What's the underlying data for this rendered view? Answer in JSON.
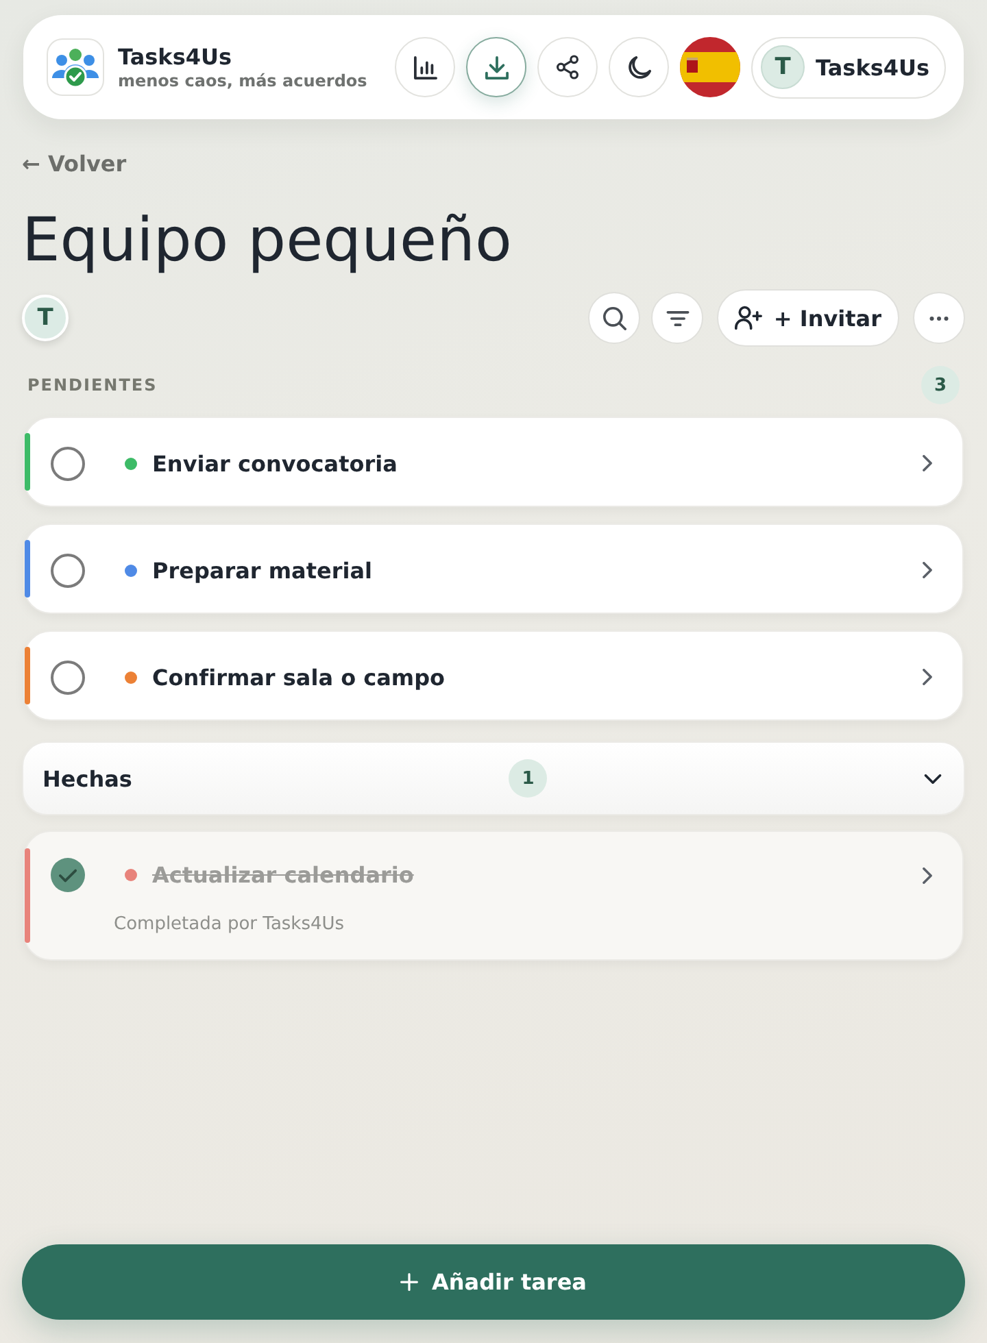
{
  "header": {
    "app_name": "Tasks4Us",
    "tagline": "menos caos, más acuerdos",
    "actions": [
      {
        "kind": "stats",
        "highlighted": false
      },
      {
        "kind": "download",
        "highlighted": true
      },
      {
        "kind": "share",
        "highlighted": false
      },
      {
        "kind": "theme",
        "highlighted": false
      },
      {
        "kind": "language",
        "highlighted": false
      }
    ],
    "user": {
      "initial": "T",
      "name": "Tasks4Us"
    }
  },
  "back_link": "← Volver",
  "title": "Equipo pequeño",
  "members": [
    {
      "initial": "T"
    }
  ],
  "toolbar": {
    "tools": [
      {
        "kind": "search"
      },
      {
        "kind": "filter"
      },
      {
        "kind": "invite",
        "label": "+ Invitar"
      },
      {
        "kind": "more"
      }
    ]
  },
  "pending": {
    "heading": "PENDIENTES",
    "count": "3",
    "tasks": [
      {
        "title": "Enviar convocatoria",
        "color": "#3dbb67",
        "done": false
      },
      {
        "title": "Preparar material",
        "color": "#4f8ae6",
        "done": false
      },
      {
        "title": "Confirmar sala o campo",
        "color": "#ec8136",
        "done": false
      }
    ]
  },
  "done": {
    "heading": "Hechas",
    "count": "1",
    "expanded": true,
    "tasks": [
      {
        "title": "Actualizar calendario",
        "color": "#e8837b",
        "done": true,
        "completed_by": "Completada por Tasks4Us"
      }
    ]
  },
  "add_button": {
    "label": "Añadir tarea"
  }
}
